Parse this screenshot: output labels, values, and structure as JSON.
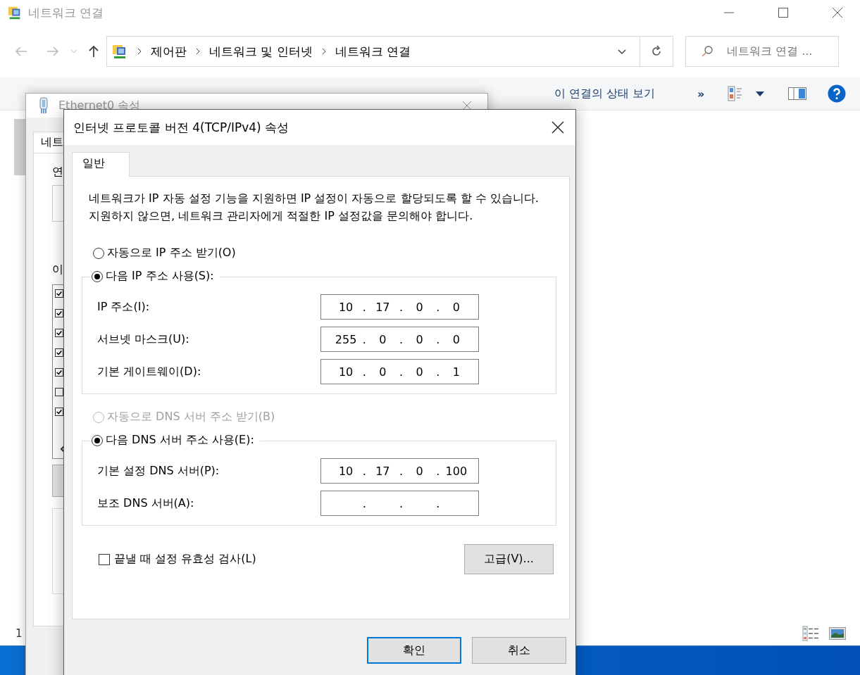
{
  "explorer": {
    "title": "네트워크 연결",
    "breadcrumb": [
      "제어판",
      "네트워크 및 인터넷",
      "네트워크 연결"
    ],
    "search": {
      "placeholder": "네트워크 연결 ..."
    },
    "commands": [
      "이 연결의 상태 보기"
    ],
    "more": "»",
    "status_text": "1"
  },
  "ethernet_dialog": {
    "title": "Ethernet0 속성",
    "tab": "네트",
    "label_1": "연",
    "label_2": "이",
    "components": [
      {
        "checked": true
      },
      {
        "checked": true
      },
      {
        "checked": true
      },
      {
        "checked": true
      },
      {
        "checked": true
      },
      {
        "checked": false
      },
      {
        "checked": true
      }
    ]
  },
  "tcp_dialog": {
    "title": "인터넷 프로토콜 버전 4(TCP/IPv4) 속성",
    "tabs": [
      {
        "label": "일반",
        "selected": true
      }
    ],
    "description": "네트워크가 IP 자동 설정 기능을 지원하면 IP 설정이 자동으로 할당되도록 할 수 있습니다. 지원하지 않으면, 네트워크 관리자에게 적절한 IP 설정값을 문의해야 합니다.",
    "separator": ".",
    "ip_options": [
      {
        "label": "자동으로 IP 주소 받기(O)",
        "selected": false,
        "disabled": false
      },
      {
        "label": "다음 IP 주소 사용(S):",
        "selected": true,
        "disabled": false
      }
    ],
    "ip_fields": [
      {
        "label": "IP 주소(I):",
        "octets": [
          "10",
          "17",
          "0",
          "0"
        ]
      },
      {
        "label": "서브넷 마스크(U):",
        "octets": [
          "255",
          "0",
          "0",
          "0"
        ]
      },
      {
        "label": "기본 게이트웨이(D):",
        "octets": [
          "10",
          "0",
          "0",
          "1"
        ]
      }
    ],
    "dns_options": [
      {
        "label": "자동으로 DNS 서버 주소 받기(B)",
        "selected": false,
        "disabled": true
      },
      {
        "label": "다음 DNS 서버 주소 사용(E):",
        "selected": true,
        "disabled": false
      }
    ],
    "dns_fields": [
      {
        "label": "기본 설정 DNS 서버(P):",
        "octets": [
          "10",
          "17",
          "0",
          "100"
        ]
      },
      {
        "label": "보조 DNS 서버(A):"
      }
    ],
    "validate": {
      "label": "끝낼 때 설정 유효성 검사(L)",
      "checked": false
    },
    "advanced_button": "고급(V)...",
    "buttons": [
      "확인",
      "취소"
    ]
  }
}
